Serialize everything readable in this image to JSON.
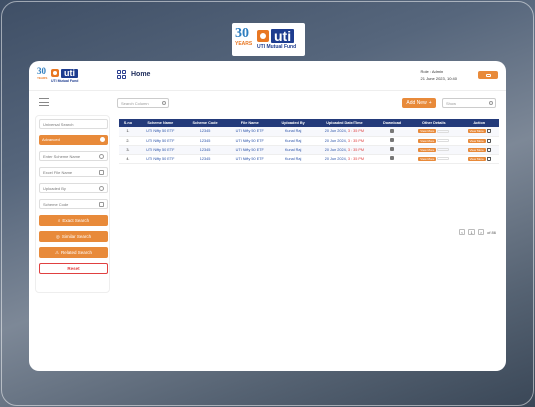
{
  "top_logo": {
    "years_number": "30",
    "years_word": "YEARS",
    "brand": "uti",
    "brand_sub": "UTI Mutual Fund"
  },
  "header": {
    "brand": "uti",
    "brand_sub": "UTI Mutual Fund",
    "years_number": "30",
    "years_word": "YEARS",
    "nav_label": "Home",
    "role": "Role : Admin",
    "datetime": "21 June 2023, 10:40"
  },
  "toolbar": {
    "search_column_placeholder": "Search Column",
    "add_new_label": "Add New",
    "add_new_icon": "+",
    "show_placeholder": "Show"
  },
  "sidebar": {
    "universal_search": "Universal Search",
    "advanced_label": "Advanced",
    "fields": [
      "Enter Scheme Name",
      "Excel File Name",
      "Uploaded By",
      "Scheme Code"
    ],
    "exact_search": "Exact Search",
    "similar_search": "Similar Search",
    "related_search": "Related Search",
    "reset": "Reset"
  },
  "table": {
    "headers": [
      "S.no",
      "Scheme Name",
      "Scheme Code",
      "File Name",
      "Uploaded By",
      "Uploaded Date/Time",
      "Download",
      "Other Details",
      "Action"
    ],
    "rows": [
      {
        "sno": "1.",
        "scheme_name": "UTI Nifty 50 ETF",
        "scheme_code": "12345",
        "file_name": "UTI Nifty 50 ETF",
        "uploaded_by": "Kunal Raj",
        "date": "20 Jun 2024,",
        "time": "3 : 35 PM",
        "other_btn": "View More",
        "action_btn": "View More"
      },
      {
        "sno": "2.",
        "scheme_name": "UTI Nifty 50 ETF",
        "scheme_code": "12345",
        "file_name": "UTI Nifty 50 ETF",
        "uploaded_by": "Kunal Raj",
        "date": "20 Jun 2024,",
        "time": "3 : 35 PM",
        "other_btn": "View More",
        "action_btn": "View More"
      },
      {
        "sno": "3.",
        "scheme_name": "UTI Nifty 50 ETF",
        "scheme_code": "12345",
        "file_name": "UTI Nifty 50 ETF",
        "uploaded_by": "Kunal Raj",
        "date": "20 Jun 2024,",
        "time": "3 : 35 PM",
        "other_btn": "View More",
        "action_btn": "View More"
      },
      {
        "sno": "4.",
        "scheme_name": "UTI Nifty 50 ETF",
        "scheme_code": "12345",
        "file_name": "UTI Nifty 50 ETF",
        "uploaded_by": "Kunal Raj",
        "date": "20 Jun 2024,",
        "time": "3 : 35 PM",
        "other_btn": "View More",
        "action_btn": "View More"
      }
    ]
  },
  "pager": {
    "prev": "<",
    "page": "1",
    "next": ">",
    "of_label": "of 86"
  },
  "colors": {
    "accent": "#e88a3a",
    "table_header": "#233a7a",
    "link": "#2a52a8",
    "danger": "#e04040"
  }
}
